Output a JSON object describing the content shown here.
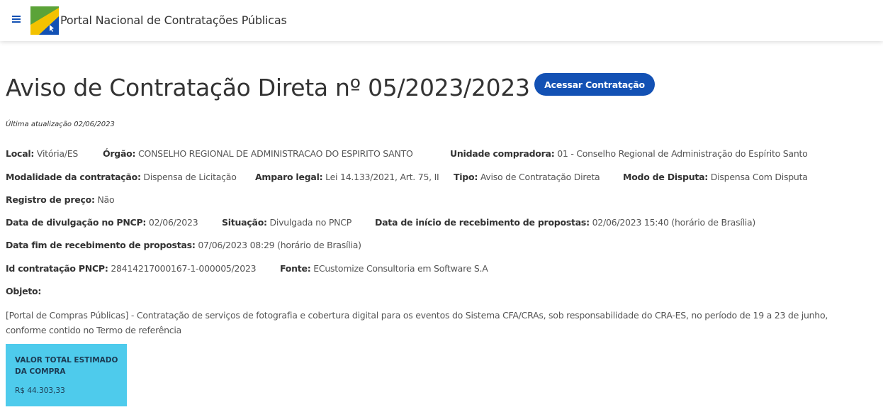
{
  "header": {
    "menu_icon": "hamburger-menu-icon",
    "portal_title": "Portal Nacional de Contratações Públicas",
    "colors": {
      "primary": "#1351b4",
      "logo_green": "#5ba338",
      "logo_yellow": "#f3c200"
    }
  },
  "page": {
    "title": "Aviso de Contratação Direta nº 05/2023/2023",
    "access_button": "Acessar Contratação",
    "last_update": "Última atualização 02/06/2023"
  },
  "fields": {
    "local": {
      "label": "Local:",
      "value": "Vitória/ES"
    },
    "orgao": {
      "label": "Órgão:",
      "value": "CONSELHO REGIONAL DE ADMINISTRACAO DO ESPIRITO SANTO"
    },
    "unidade": {
      "label": "Unidade compradora:",
      "value": "01 - Conselho Regional de Administração do Espírito Santo"
    },
    "modalidade": {
      "label": "Modalidade da contratação:",
      "value": "Dispensa de Licitação"
    },
    "amparo": {
      "label": "Amparo legal:",
      "value": "Lei 14.133/2021, Art. 75, II"
    },
    "tipo": {
      "label": "Tipo:",
      "value": "Aviso de Contratação Direta"
    },
    "modo": {
      "label": "Modo de Disputa:",
      "value": "Dispensa Com Disputa"
    },
    "registro": {
      "label": "Registro de preço:",
      "value": "Não"
    },
    "divulgacao": {
      "label": "Data de divulgação no PNCP:",
      "value": "02/06/2023"
    },
    "situacao": {
      "label": "Situação:",
      "value": "Divulgada no PNCP"
    },
    "inicio": {
      "label": "Data de início de recebimento de propostas:",
      "value": "02/06/2023 15:40 (horário de Brasília)"
    },
    "fim": {
      "label": "Data fim de recebimento de propostas:",
      "value": "07/06/2023 08:29 (horário de Brasília)"
    },
    "id": {
      "label": "Id contratação PNCP:",
      "value": "28414217000167-1-000005/2023"
    },
    "fonte": {
      "label": "Fonte:",
      "value": "ECustomize Consultoria em Software S.A"
    },
    "objeto": {
      "label": "Objeto:"
    }
  },
  "objeto_text": "[Portal de Compras Públicas] - Contratação de serviços de fotografia e cobertura digital para os eventos do Sistema CFA/CRAs, sob responsabilidade do CRA-ES, no período de 19 a 23 de junho, conforme contido no Termo de referência",
  "value_card": {
    "label": "VALOR TOTAL ESTIMADO DA COMPRA",
    "amount": "R$ 44.303,33",
    "color": "#4ecbec"
  }
}
